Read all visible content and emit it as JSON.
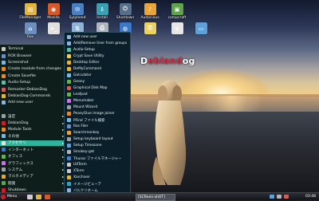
{
  "watermark": {
    "part1": "D",
    "part2": "ebiand",
    "part3": "og"
  },
  "desktop_icons": [
    {
      "label": "FileManager",
      "color": "#e3b53c",
      "glyph": "folder-icon"
    },
    {
      "label": "Mozilla",
      "color": "#d35a2b",
      "glyph": "browser-icon"
    },
    {
      "label": "Sylpheed",
      "color": "#4a7fc0",
      "glyph": "mail-icon"
    },
    {
      "label": "Install",
      "color": "#3aa1b2",
      "glyph": "install-icon"
    },
    {
      "label": "Shutdown",
      "color": "#586f8a",
      "glyph": "power-icon"
    },
    {
      "label": "Audacious",
      "color": "#e8a53a",
      "glyph": "music-icon"
    },
    {
      "label": "compcraft",
      "color": "#5fa34a",
      "glyph": "package-icon"
    },
    {
      "label": "Rox",
      "color": "#6c8fbf",
      "glyph": "rox-icon"
    },
    {
      "label": "",
      "color": "#e0e0e0",
      "glyph": "terminal-icon"
    },
    {
      "label": "",
      "color": "#8fb3d9",
      "glyph": "network-icon"
    },
    {
      "label": "",
      "color": "#b0b5bd",
      "glyph": "printer-icon"
    },
    {
      "label": "",
      "color": "#3d78c7",
      "glyph": "globe-icon"
    },
    {
      "label": "",
      "color": "#ecd25a",
      "glyph": "lock-icon"
    },
    {
      "label": "",
      "color": "#e6e6e6",
      "glyph": "document-icon"
    },
    {
      "label": "",
      "color": "#5ea0d8",
      "glyph": "monitor-icon"
    }
  ],
  "main_menu": [
    {
      "label": "Terminal",
      "color": "#c8c8c8"
    },
    {
      "label": "ROX Browser",
      "color": "#6c8fbf"
    },
    {
      "label": "Screenshot",
      "color": "#7fb7d9"
    },
    {
      "label": "Create module from changes",
      "color": "#e58a2e"
    },
    {
      "label": "Create Savefile",
      "color": "#e58a2e"
    },
    {
      "label": "Audio-Setup",
      "color": "#5bbfa2"
    },
    {
      "label": "Remaster-DebianDog",
      "color": "#d25b5b"
    },
    {
      "label": "DebianDog-Commands",
      "color": "#e3b53c"
    },
    {
      "label": "Add new user",
      "color": "#8fb3d9"
    },
    {
      "label": "",
      "color": "#0e1e1b"
    },
    {
      "label": "設定",
      "color": "#9aa0a8"
    },
    {
      "label": "DebianDog",
      "color": "#d11c2c"
    },
    {
      "label": "Module Tools",
      "color": "#e58a2e"
    },
    {
      "label": "その他",
      "color": "#7fb7d9"
    },
    {
      "label": "アクセサリ",
      "color": "#e3e3e3"
    },
    {
      "label": "インターネット",
      "color": "#3d78c7"
    },
    {
      "label": "オフィス",
      "color": "#6ab04c"
    },
    {
      "label": "グラフィックス",
      "color": "#c67ad8"
    },
    {
      "label": "システム",
      "color": "#9aa0a8"
    },
    {
      "label": "マルチメディア",
      "color": "#e8a53a"
    },
    {
      "label": "開発",
      "color": "#5fa34a"
    },
    {
      "label": "Shutdown",
      "color": "#d11c2c"
    }
  ],
  "main_menu_selected_index": 14,
  "submenu": [
    {
      "label": "Add new user",
      "color": "#8fb3d9"
    },
    {
      "label": "Add/Remove User from groups",
      "color": "#8fb3d9"
    },
    {
      "label": "Audio-Setup",
      "color": "#5bbfa2"
    },
    {
      "label": "Crypt Save Utility",
      "color": "#ecd25a"
    },
    {
      "label": "Desktop Editor",
      "color": "#e3b53c"
    },
    {
      "label": "DeMyCommand",
      "color": "#e3b53c"
    },
    {
      "label": "Galculator",
      "color": "#7fb7d9"
    },
    {
      "label": "Geany",
      "color": "#6ab04c"
    },
    {
      "label": "Graphical Disk Map",
      "color": "#d25b5b"
    },
    {
      "label": "Leafpad",
      "color": "#6ab04c"
    },
    {
      "label": "Menumaker",
      "color": "#c67ad8"
    },
    {
      "label": "Mount Wizard",
      "color": "#9aa0a8"
    },
    {
      "label": "PeasyGlue image joiner",
      "color": "#e58a2e"
    },
    {
      "label": "PFind ファイル検索",
      "color": "#7fb7d9"
    },
    {
      "label": "Rox Filer",
      "color": "#6c8fbf"
    },
    {
      "label": "Searchmonkey",
      "color": "#e8a53a"
    },
    {
      "label": "Setup keyboard layout",
      "color": "#9aa0a8"
    },
    {
      "label": "Setup Timezone",
      "color": "#5ea0d8"
    },
    {
      "label": "Smokey-get",
      "color": "#b0b5bd"
    },
    {
      "label": "Thunar ファイルマネージャー",
      "color": "#4a7fc0"
    },
    {
      "label": "UXTerm",
      "color": "#c8c8c8"
    },
    {
      "label": "XTerm",
      "color": "#c8c8c8"
    },
    {
      "label": "Xarchiver",
      "color": "#e3b53c"
    },
    {
      "label": "イメージビューア",
      "color": "#3aa1b2"
    },
    {
      "label": "バルクリネーム",
      "color": "#8fb3d9"
    }
  ],
  "taskbar": {
    "menu_label": "Menu",
    "task_label": "[SCReen-shOT]",
    "clock": "03:48",
    "colors": {
      "menu_ball": "#d11c2c",
      "accent": "#2fb39a"
    }
  }
}
